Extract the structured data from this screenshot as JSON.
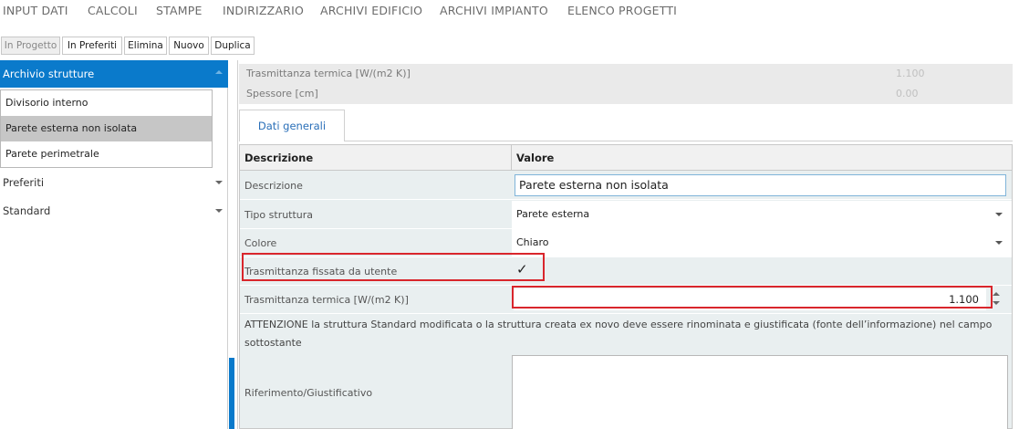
{
  "menu": {
    "items": [
      "INPUT DATI",
      "CALCOLI",
      "STAMPE",
      "INDIRIZZARIO",
      "ARCHIVI EDIFICIO",
      "ARCHIVI IMPIANTO",
      "ELENCO PROGETTI"
    ]
  },
  "toolbar": {
    "in_progetto": "In Progetto",
    "in_preferiti": "In Preferiti",
    "elimina": "Elimina",
    "nuovo": "Nuovo",
    "duplica": "Duplica"
  },
  "sidebar": {
    "archivio_title": "Archivio strutture",
    "items": [
      "Divisorio interno",
      "Parete esterna non isolata",
      "Parete perimetrale"
    ],
    "selected_index": 1,
    "preferiti": "Preferiti",
    "standard": "Standard"
  },
  "summary": {
    "trasmittanza_label": "Trasmittanza termica [W/(m2 K)]",
    "trasmittanza_value": "1.100",
    "spessore_label": "Spessore [cm]",
    "spessore_value": "0.00"
  },
  "tabs": {
    "dati_generali": "Dati generali"
  },
  "grid": {
    "col_descrizione": "Descrizione",
    "col_valore": "Valore",
    "descrizione_label": "Descrizione",
    "descrizione_value": "Parete esterna non isolata",
    "tipo_label": "Tipo struttura",
    "tipo_value": "Parete esterna",
    "colore_label": "Colore",
    "colore_value": "Chiaro",
    "fissata_label": "Trasmittanza fissata da utente",
    "fissata_checked": true,
    "check_glyph": "✓",
    "trasm_label": "Trasmittanza termica [W/(m2 K)]",
    "trasm_value": "1.100",
    "warning": "ATTENZIONE la struttura Standard modificata o la struttura creata ex novo deve essere rinominata e giustificata (fonte dell’informazione) nel campo sottostante",
    "riferimento_label": "Riferimento/Giustificativo",
    "riferimento_value": ""
  },
  "colors": {
    "accent": "#0a7acb",
    "highlight": "#d9262c",
    "selected_row": "#c6c6c6"
  }
}
